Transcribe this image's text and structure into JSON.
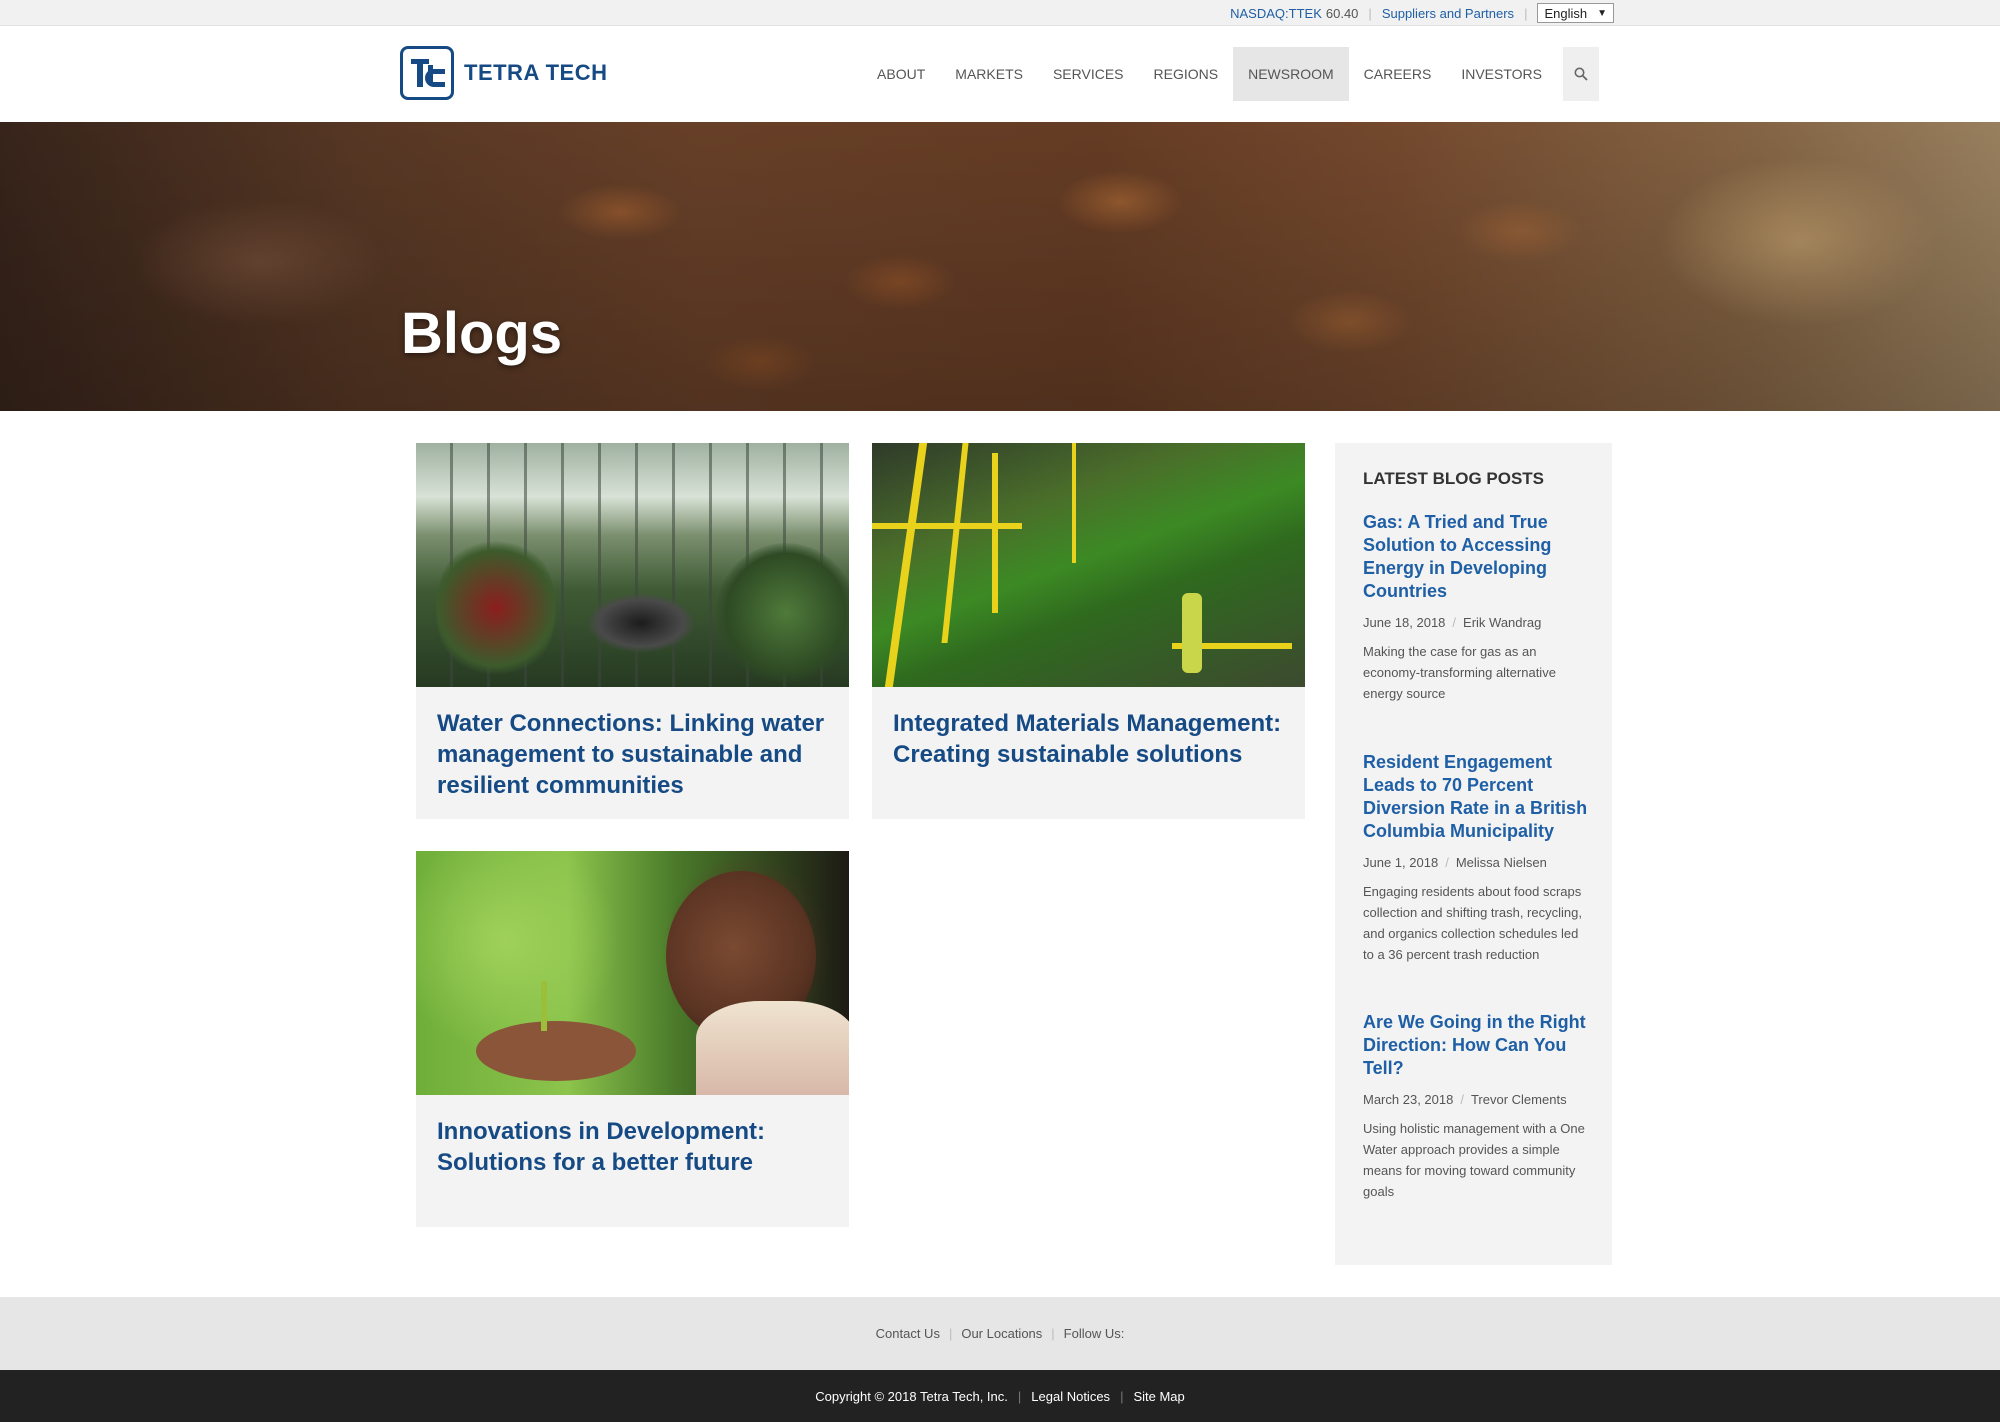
{
  "utility": {
    "ticker": "NASDAQ:TTEK",
    "price": "60.40",
    "suppliers": "Suppliers and Partners",
    "language": "English"
  },
  "brand": {
    "name": "TETRA TECH",
    "color": "#164a84"
  },
  "nav": {
    "items": [
      {
        "label": "ABOUT"
      },
      {
        "label": "MARKETS"
      },
      {
        "label": "SERVICES"
      },
      {
        "label": "REGIONS"
      },
      {
        "label": "NEWSROOM",
        "active": true
      },
      {
        "label": "CAREERS"
      },
      {
        "label": "INVESTORS"
      }
    ],
    "search_icon": "search-icon"
  },
  "hero": {
    "title": "Blogs"
  },
  "cards": [
    {
      "title": "Water Connections: Linking water management to sustainable and resilient communities",
      "image": "greenhouse-image"
    },
    {
      "title": "Integrated Materials Management: Creating sustainable solutions",
      "image": "recycling-facility-image"
    },
    {
      "title": "Innovations in Development: Solutions for a better future",
      "image": "farmer-seedling-image"
    }
  ],
  "sidebar": {
    "heading": "LATEST BLOG POSTS",
    "posts": [
      {
        "title": "Gas: A Tried and True Solution to Accessing Energy in Developing Countries",
        "date": "June 18, 2018",
        "author": "Erik Wandrag",
        "excerpt": "Making the case for gas as an economy-transforming alternative energy source"
      },
      {
        "title": "Resident Engagement Leads to 70 Percent Diversion Rate in a British Columbia Municipality",
        "date": "June 1, 2018",
        "author": "Melissa Nielsen",
        "excerpt": "Engaging residents about food scraps collection and shifting trash, recycling, and organics collection schedules led to a 36 percent trash reduction"
      },
      {
        "title": "Are We Going in the Right Direction: How Can You Tell?",
        "date": "March 23, 2018",
        "author": "Trevor Clements",
        "excerpt": "Using holistic management with a One Water approach provides a simple means for moving toward community goals"
      }
    ]
  },
  "footer": {
    "contact": "Contact Us",
    "locations": "Our Locations",
    "follow": "Follow Us:",
    "copyright": "Copyright © 2018 Tetra Tech, Inc.",
    "legal": "Legal Notices",
    "sitemap": "Site Map"
  }
}
